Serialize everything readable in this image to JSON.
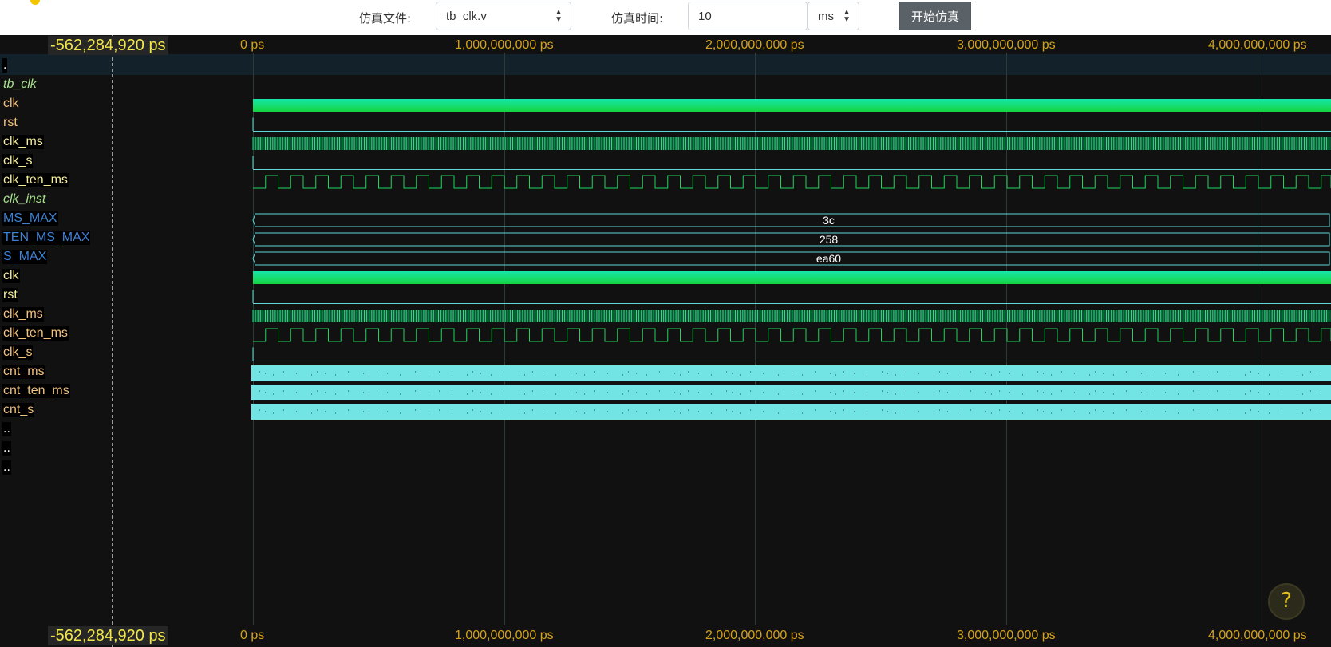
{
  "toolbar": {
    "file_label": "仿真文件:",
    "file_selected": "tb_clk.v",
    "time_label": "仿真时间:",
    "time_value": "10",
    "unit_selected": "ms",
    "start_button": "开始仿真"
  },
  "viewer": {
    "cursor_time": "-562,284,920 ps",
    "ticks": [
      "0 ps",
      "1,000,000,000 ps",
      "2,000,000,000 ps",
      "3,000,000,000 ps",
      "4,000,000,000 ps"
    ],
    "help_label": "?",
    "colors": {
      "background": "#111111",
      "grid": "#2e3a3a",
      "wave_green": "#1fd65a",
      "wave_cyan": "#5ed8d8",
      "bus_fill": "#72e4e4",
      "tick_label": "#d4a21a",
      "cursor": "#f2e64a"
    }
  },
  "signals": [
    {
      "name": ".",
      "kind": "dot",
      "selected": true
    },
    {
      "name": "tb_clk",
      "kind": "scope"
    },
    {
      "name": "clk",
      "kind": "dense",
      "name_color": "#f4c07a"
    },
    {
      "name": "rst",
      "kind": "low",
      "name_color": "#f4c07a"
    },
    {
      "name": "clk_ms",
      "kind": "fastclk",
      "name_color": "#f4ee9a",
      "selected": true
    },
    {
      "name": "clk_s",
      "kind": "low",
      "name_color": "#f4ee9a",
      "selected": true
    },
    {
      "name": "clk_ten_ms",
      "kind": "clock",
      "name_color": "#f4ee9a",
      "selected": true
    },
    {
      "name": "clk_inst",
      "kind": "scope"
    },
    {
      "name": "MS_MAX",
      "kind": "bus",
      "value": "3c",
      "name_color": "#3a82d6",
      "selected": true
    },
    {
      "name": "TEN_MS_MAX",
      "kind": "bus",
      "value": "258",
      "name_color": "#3a82d6",
      "selected": true
    },
    {
      "name": "S_MAX",
      "kind": "bus",
      "value": "ea60",
      "name_color": "#3a82d6",
      "selected": true
    },
    {
      "name": "clk",
      "kind": "dense",
      "name_color": "#f4ee9a",
      "selected": true
    },
    {
      "name": "rst",
      "kind": "low",
      "name_color": "#f4ee9a",
      "selected": true
    },
    {
      "name": "clk_ms",
      "kind": "fastclk",
      "name_color": "#f4c07a",
      "selected": true
    },
    {
      "name": "clk_ten_ms",
      "kind": "clock",
      "name_color": "#f4c07a",
      "selected": true
    },
    {
      "name": "clk_s",
      "kind": "low",
      "name_color": "#f4c07a",
      "selected": true
    },
    {
      "name": "cnt_ms",
      "kind": "busfill",
      "name_color": "#f4c07a",
      "selected": true
    },
    {
      "name": "cnt_ten_ms",
      "kind": "busfill",
      "name_color": "#f4c07a",
      "selected": true
    },
    {
      "name": "cnt_s",
      "kind": "busfill",
      "name_color": "#f4c07a",
      "selected": true
    },
    {
      "name": "..",
      "kind": "dot",
      "selected": true
    },
    {
      "name": "..",
      "kind": "dot",
      "selected": true
    },
    {
      "name": "..",
      "kind": "dot",
      "selected": true
    }
  ]
}
